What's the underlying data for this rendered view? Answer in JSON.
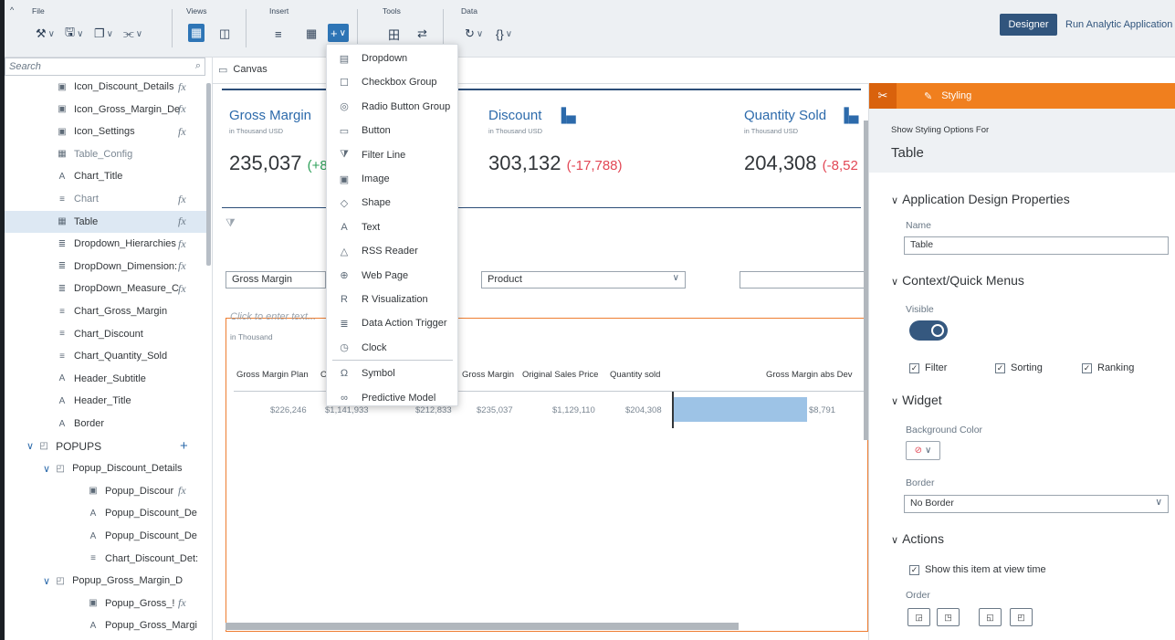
{
  "toolbar": {
    "groups": {
      "file": "File",
      "views": "Views",
      "insert": "Insert",
      "tools": "Tools",
      "data": "Data"
    },
    "designer": "Designer",
    "run_app": "Run Analytic Application"
  },
  "outline": {
    "search_placeholder": "Search",
    "items": [
      {
        "label": "Icon_Discount_Details",
        "icon": "image-icon",
        "fx": "fx"
      },
      {
        "label": "Icon_Gross_Margin_De",
        "icon": "image-icon",
        "fx": "fx"
      },
      {
        "label": "Icon_Settings",
        "icon": "image-icon",
        "fx": "fx"
      },
      {
        "label": "Table_Config",
        "icon": "table-icon"
      },
      {
        "label": "Chart_Title",
        "icon": "text-icon"
      },
      {
        "label": "Chart",
        "icon": "chart-icon",
        "fx": "fx"
      },
      {
        "label": "Table",
        "icon": "table-icon",
        "fx": "fx"
      },
      {
        "label": "Dropdown_Hierarchies",
        "icon": "dropdown-icon",
        "fx": "fx"
      },
      {
        "label": "DropDown_Dimension:",
        "icon": "dropdown-icon",
        "fx": "fx"
      },
      {
        "label": "DropDown_Measure_C",
        "icon": "dropdown-icon",
        "fx": "fx"
      },
      {
        "label": "Chart_Gross_Margin",
        "icon": "chart-icon"
      },
      {
        "label": "Chart_Discount",
        "icon": "chart-icon"
      },
      {
        "label": "Chart_Quantity_Sold",
        "icon": "chart-icon"
      },
      {
        "label": "Header_Subtitle",
        "icon": "text-icon"
      },
      {
        "label": "Header_Title",
        "icon": "text-icon"
      },
      {
        "label": "Border",
        "icon": "text-icon"
      },
      {
        "label": "POPUPS",
        "icon": "popup-icon"
      },
      {
        "label": "Popup_Discount_Details",
        "icon": "popup-icon"
      },
      {
        "label": "Popup_Discour",
        "icon": "image-icon",
        "fx": "fx"
      },
      {
        "label": "Popup_Discount_De",
        "icon": "text-icon"
      },
      {
        "label": "Popup_Discount_De",
        "icon": "text-icon"
      },
      {
        "label": "Chart_Discount_Det:",
        "icon": "chart-icon"
      },
      {
        "label": "Popup_Gross_Margin_D",
        "icon": "popup-icon"
      },
      {
        "label": "Popup_Gross_!",
        "icon": "image-icon",
        "fx": "fx"
      },
      {
        "label": "Popup_Gross_Margi",
        "icon": "text-icon"
      }
    ],
    "plus": "+"
  },
  "canvas": {
    "tab": "Canvas",
    "kpis": [
      {
        "title": "Gross Margin",
        "sub": "in Thousand USD",
        "value": "235,037",
        "delta": "(+8"
      },
      {
        "title": "Discount",
        "sub": "in Thousand USD",
        "value": "303,132",
        "delta": "(-17,788)"
      },
      {
        "title": "Quantity Sold",
        "sub": "in Thousand USD",
        "value": "204,308",
        "delta": "(-8,52"
      }
    ],
    "dropdowns": {
      "gross_margin": "Gross Margin",
      "product": "Product",
      "empty": ""
    },
    "placeholder": "Click to enter text...",
    "unit": "in Thousand",
    "table_headers": [
      "Gross Margin Plan",
      "Or",
      "Gross Margin",
      "Original Sales Price",
      "Quantity sold",
      "Gross Margin abs Dev"
    ],
    "table_values": [
      "$226,246",
      "$1,141,933",
      "$212,833",
      "$235,037",
      "$1,129,110",
      "$204,308",
      "$8,791"
    ]
  },
  "menu": {
    "items": [
      {
        "label": "Dropdown",
        "icon": "dropdown-icon"
      },
      {
        "label": "Checkbox Group",
        "icon": "checkbox-group-icon"
      },
      {
        "label": "Radio Button Group",
        "icon": "radio-group-icon"
      },
      {
        "label": "Button",
        "icon": "button-icon"
      },
      {
        "label": "Filter Line",
        "icon": "filter-icon"
      },
      {
        "label": "Image",
        "icon": "image-icon"
      },
      {
        "label": "Shape",
        "icon": "shape-icon"
      },
      {
        "label": "Text",
        "icon": "text-icon"
      },
      {
        "label": "RSS Reader",
        "icon": "rss-icon"
      },
      {
        "label": "Web Page",
        "icon": "globe-icon"
      },
      {
        "label": "R Visualization",
        "icon": "r-icon"
      },
      {
        "label": "Data Action Trigger",
        "icon": "data-action-icon"
      },
      {
        "label": "Clock",
        "icon": "clock-icon"
      },
      {
        "label": "Symbol",
        "icon": "symbol-icon"
      },
      {
        "label": "Predictive Model",
        "icon": "binoculars-icon"
      }
    ]
  },
  "panel": {
    "tab": "Styling",
    "show_for": "Show Styling Options For",
    "target": "Table",
    "sec_app": "Application Design Properties",
    "name_label": "Name",
    "name_value": "Table",
    "sec_ctx": "Context/Quick Menus",
    "visible_label": "Visible",
    "visible_on": true,
    "chk_filter": "Filter",
    "chk_sorting": "Sorting",
    "chk_ranking": "Ranking",
    "sec_widget": "Widget",
    "bg_label": "Background Color",
    "border_label": "Border",
    "border_value": "No Border",
    "sec_actions": "Actions",
    "show_item": "Show this item at view time",
    "order_label": "Order"
  }
}
